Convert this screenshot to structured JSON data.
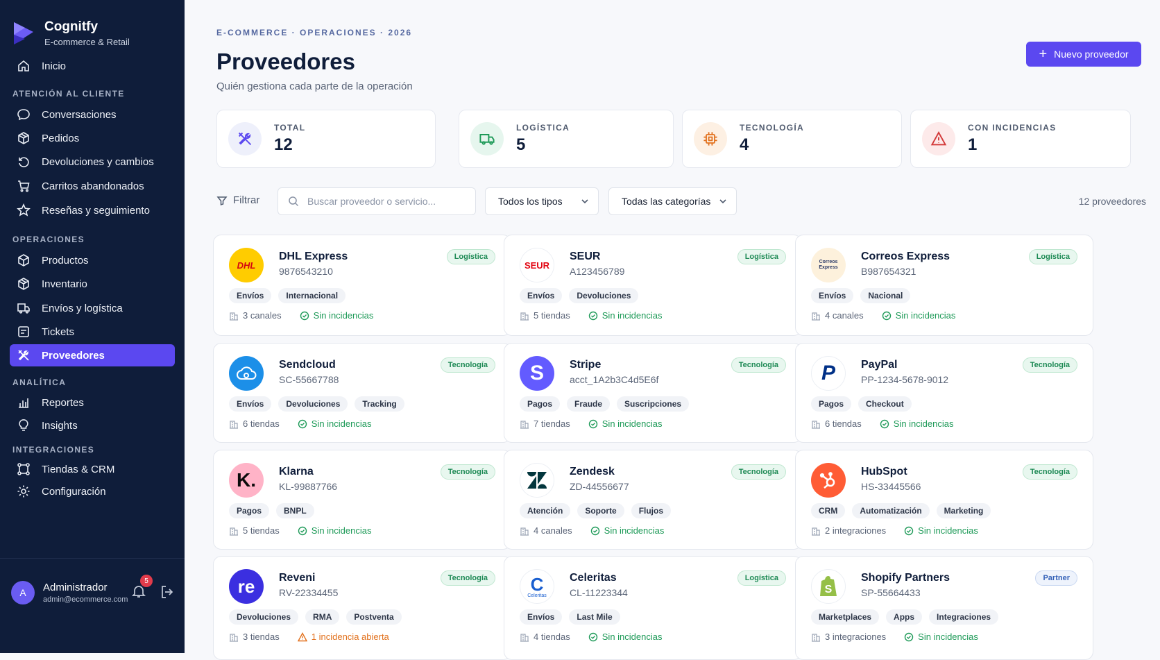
{
  "brand": {
    "name": "Cognitfy",
    "subtitle": "E-commerce & Retail"
  },
  "nav": {
    "home": "Inicio",
    "sections": [
      "ATENCIÓN AL CLIENTE",
      "OPERACIONES",
      "ANALÍTICA",
      "INTEGRACIONES"
    ],
    "items": [
      {
        "label": "Conversaciones",
        "icon": "chat-icon"
      },
      {
        "label": "Pedidos",
        "icon": "box-icon"
      },
      {
        "label": "Devoluciones y cambios",
        "icon": "return-icon"
      },
      {
        "label": "Carritos abandonados",
        "icon": "cart-icon"
      },
      {
        "label": "Reseñas y seguimiento",
        "icon": "star-icon"
      },
      {
        "label": "Productos",
        "icon": "cube-icon"
      },
      {
        "label": "Inventario",
        "icon": "inventory-icon"
      },
      {
        "label": "Envíos y logística",
        "icon": "shipping-icon"
      },
      {
        "label": "Tickets",
        "icon": "ticket-icon"
      },
      {
        "label": "Proveedores",
        "icon": "tools-icon",
        "active": true
      },
      {
        "label": "Reportes",
        "icon": "bar-chart-icon"
      },
      {
        "label": "Insights",
        "icon": "bulb-icon"
      },
      {
        "label": "Tiendas & CRM",
        "icon": "network-icon"
      },
      {
        "label": "Configuración",
        "icon": "gear-icon"
      }
    ]
  },
  "user": {
    "initial": "A",
    "name": "Administrador",
    "email": "admin@ecommerce.com",
    "notifications": "5"
  },
  "header": {
    "breadcrumb": "E-COMMERCE · OPERACIONES · 2026",
    "title": "Proveedores",
    "subtitle": "Quién gestiona cada parte de la operación",
    "new_button": "Nuevo proveedor"
  },
  "stats": [
    {
      "label": "TOTAL",
      "value": "12"
    },
    {
      "label": "LOGÍSTICA",
      "value": "5"
    },
    {
      "label": "TECNOLOGÍA",
      "value": "4"
    },
    {
      "label": "CON INCIDENCIAS",
      "value": "1"
    }
  ],
  "toolbar": {
    "filter_label": "Filtrar",
    "search_placeholder": "Buscar proveedor o servicio...",
    "type_select": "Todos los tipos",
    "category_select": "Todas las categorías",
    "count": "12 proveedores"
  },
  "colors": {
    "accent": "#5b48f0",
    "sidebar": "#0f1d3a",
    "ok": "#1e9a58",
    "warn": "#e2711d"
  },
  "providers": [
    {
      "name": "DHL Express",
      "code": "9876543210",
      "badge": "Logística",
      "tags": [
        "Envíos",
        "Internacional"
      ],
      "meta": "3 canales",
      "status": "Sin incidencias",
      "logo_text": "DHL"
    },
    {
      "name": "SEUR",
      "code": "A123456789",
      "badge": "Logística",
      "tags": [
        "Envíos",
        "Devoluciones"
      ],
      "meta": "5 tiendas",
      "status": "Sin incidencias",
      "logo_text": "SEUR"
    },
    {
      "name": "Correos Express",
      "code": "B987654321",
      "badge": "Logística",
      "tags": [
        "Envíos",
        "Nacional"
      ],
      "meta": "4 canales",
      "status": "Sin incidencias",
      "logo_text": "Correos Express"
    },
    {
      "name": "Sendcloud",
      "code": "SC-55667788",
      "badge": "Tecnología",
      "tags": [
        "Envíos",
        "Devoluciones",
        "Tracking"
      ],
      "meta": "6 tiendas",
      "status": "Sin incidencias",
      "logo_text": ""
    },
    {
      "name": "Stripe",
      "code": "acct_1A2b3C4d5E6f",
      "badge": "Tecnología",
      "tags": [
        "Pagos",
        "Fraude",
        "Suscripciones"
      ],
      "meta": "7 tiendas",
      "status": "Sin incidencias",
      "logo_text": "S"
    },
    {
      "name": "PayPal",
      "code": "PP-1234-5678-9012",
      "badge": "Tecnología",
      "tags": [
        "Pagos",
        "Checkout"
      ],
      "meta": "6 tiendas",
      "status": "Sin incidencias",
      "logo_text": "P"
    },
    {
      "name": "Klarna",
      "code": "KL-99887766",
      "badge": "Tecnología",
      "tags": [
        "Pagos",
        "BNPL"
      ],
      "meta": "5 tiendas",
      "status": "Sin incidencias",
      "logo_text": "K."
    },
    {
      "name": "Zendesk",
      "code": "ZD-44556677",
      "badge": "Tecnología",
      "tags": [
        "Atención",
        "Soporte",
        "Flujos"
      ],
      "meta": "4 canales",
      "status": "Sin incidencias",
      "logo_text": ""
    },
    {
      "name": "HubSpot",
      "code": "HS-33445566",
      "badge": "Tecnología",
      "tags": [
        "CRM",
        "Automatización",
        "Marketing"
      ],
      "meta": "2 integraciones",
      "status": "Sin incidencias",
      "logo_text": ""
    },
    {
      "name": "Reveni",
      "code": "RV-22334455",
      "badge": "Tecnología",
      "tags": [
        "Devoluciones",
        "RMA",
        "Postventa"
      ],
      "meta": "3 tiendas",
      "status": "1 incidencia abierta",
      "warn": true,
      "logo_text": "re"
    },
    {
      "name": "Celeritas",
      "code": "CL-11223344",
      "badge": "Logística",
      "tags": [
        "Envíos",
        "Last Mile"
      ],
      "meta": "4 tiendas",
      "status": "Sin incidencias",
      "logo_text": "Celeritas"
    },
    {
      "name": "Shopify Partners",
      "code": "SP-55664433",
      "badge": "Partner",
      "tags": [
        "Marketplaces",
        "Apps",
        "Integraciones"
      ],
      "meta": "3 integraciones",
      "status": "Sin incidencias",
      "logo_text": "S"
    }
  ]
}
